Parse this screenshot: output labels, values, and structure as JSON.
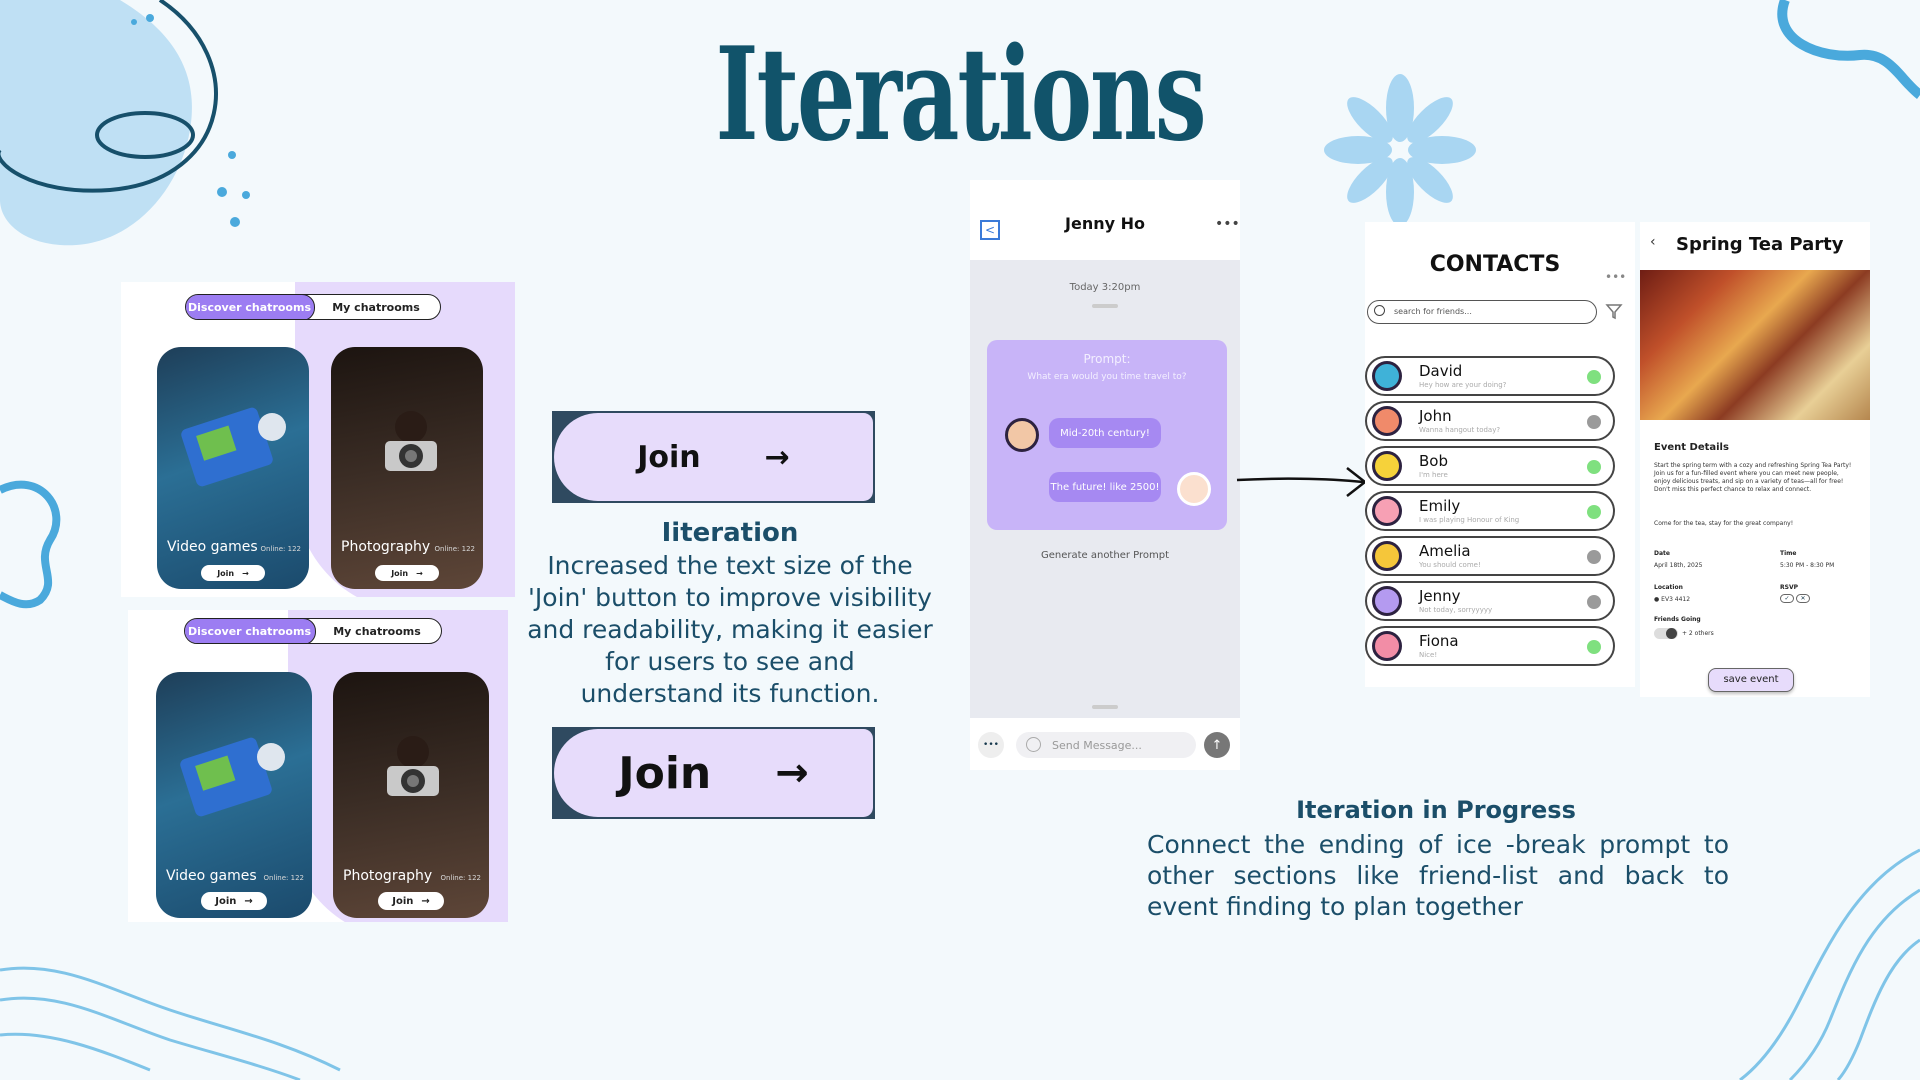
{
  "slide": {
    "title": "Iterations"
  },
  "chatrooms": {
    "tab_discover": "Discover chatrooms",
    "tab_mine": "My chatrooms",
    "cards": [
      {
        "label": "Video games",
        "online": "Online: 122",
        "join": "Join"
      },
      {
        "label": "Photography",
        "online": "Online: 122",
        "join": "Join"
      }
    ]
  },
  "join_buttons": {
    "label": "Join",
    "arrow": "→"
  },
  "iteration_left": {
    "heading": "Iiteration",
    "lines": [
      "Increased the text size of the",
      "'Join' button to improve visibility",
      "and readability, making it easier",
      "for users to see and",
      "understand its function."
    ]
  },
  "chat": {
    "contact_name": "Jenny Ho",
    "menu_icon": "more-icon",
    "timestamp": "Today 3:20pm",
    "prompt_label": "Prompt:",
    "prompt_question": "What era would you time travel to?",
    "msg_received": "Mid-20th century!",
    "msg_sent": "The future! like 2500!",
    "generate": "Generate another Prompt",
    "input_placeholder": "Send Message..."
  },
  "contacts": {
    "title": "CONTACTS",
    "search_placeholder": "search for friends...",
    "list": [
      {
        "name": "David",
        "status": "Hey how are your doing?",
        "online": true,
        "avatar_color": "#3fb2d8"
      },
      {
        "name": "John",
        "status": "Wanna hangout today?",
        "online": false,
        "avatar_color": "#f08a6a"
      },
      {
        "name": "Bob",
        "status": "I'm here",
        "online": true,
        "avatar_color": "#f6d23a"
      },
      {
        "name": "Emily",
        "status": "I was playing Honour of King",
        "online": true,
        "avatar_color": "#f7a0b4"
      },
      {
        "name": "Amelia",
        "status": "You should come!",
        "online": false,
        "avatar_color": "#f5c63a"
      },
      {
        "name": "Jenny",
        "status": "Not today, sorryyyyy",
        "online": false,
        "avatar_color": "#b49af0"
      },
      {
        "name": "Fiona",
        "status": "Nice!",
        "online": true,
        "avatar_color": "#f28da6"
      }
    ],
    "online_color": "#7fe07f",
    "offline_color": "#9a9a9a"
  },
  "event": {
    "title": "Spring Tea Party",
    "details_heading": "Event Details",
    "description": "Start the spring term with a cozy and refreshing Spring Tea Party! Join us for a fun-filled event where you can meet new people, enjoy delicious treats, and sip on a variety of teas—all for free! Don't miss this perfect chance to relax and connect.",
    "tagline": "Come for the tea, stay for the great company!",
    "date_label": "Date",
    "date_value": "April 18th, 2025",
    "time_label": "Time",
    "time_value": "5:30 PM - 8:30 PM",
    "location_label": "Location",
    "location_value": "EV3 4412",
    "rsvp_label": "RSVP",
    "friends_label": "Friends Going",
    "friends_value": "+ 2 others",
    "save_label": "save event"
  },
  "iteration_right": {
    "heading": "Iteration in Progress",
    "body": "Connect the ending of ice -break prompt to other sections like friend-list and back to event finding to plan together"
  },
  "colors": {
    "accent_purple": "#9c7df2",
    "title_teal": "#11536a",
    "deco_blue": "#4aa9dc"
  }
}
